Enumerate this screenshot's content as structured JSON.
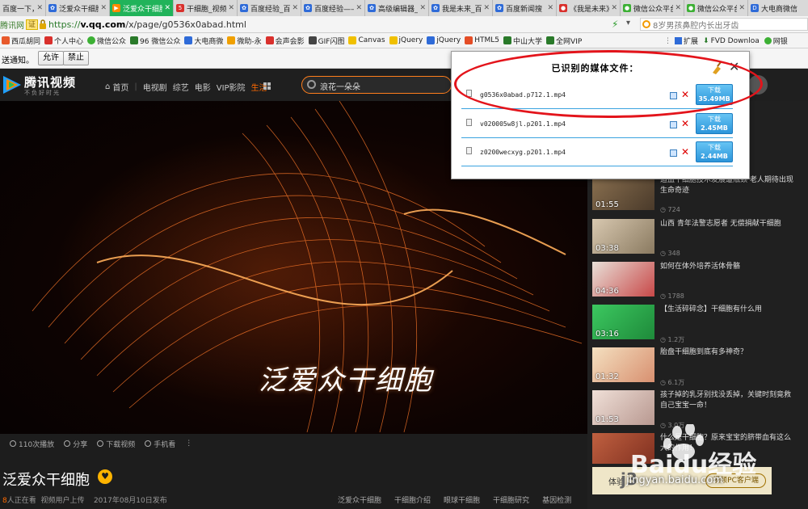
{
  "browser": {
    "tabs": [
      {
        "title": "百度一下，你",
        "favicon_color": "#2f6bd8"
      },
      {
        "title": "泛爱众干细胞",
        "favicon_color": "#2f6bd8"
      },
      {
        "title": "泛爱众干细胞",
        "favicon_color": "#ff8a00",
        "active": true
      },
      {
        "title": "干细胞_视频",
        "favicon_color": "#d9302c"
      },
      {
        "title": "百度经验_百",
        "favicon_color": "#2f6bd8"
      },
      {
        "title": "百度经验——",
        "favicon_color": "#2f6bd8"
      },
      {
        "title": "高级编辑器_",
        "favicon_color": "#2f6bd8"
      },
      {
        "title": "我是未来_百",
        "favicon_color": "#2f6bd8"
      },
      {
        "title": "百度新闻搜",
        "favicon_color": "#2f6bd8"
      },
      {
        "title": "《我是未来》",
        "favicon_color": "#d9302c"
      },
      {
        "title": "微信公众平台",
        "favicon_color": "#3cb034"
      },
      {
        "title": "微信公众平台",
        "favicon_color": "#3cb034"
      },
      {
        "title": "大电商微信",
        "favicon_color": "#2f6bd8"
      }
    ],
    "site_badge": "腾讯网",
    "cert_label": "证",
    "url_scheme": "https://",
    "url_host": "v.qq.com",
    "url_path": "/x/page/g0536x0abad.html",
    "search_placeholder": "8岁男孩鼻腔内长出牙齿",
    "bookmarks": [
      {
        "label": "西瓜胡同",
        "color": "#e85a2c"
      },
      {
        "label": "个人中心",
        "color": "#d9302c"
      },
      {
        "label": "微信公众",
        "color": "#3cb034"
      },
      {
        "label": "96 微信公众",
        "color": "#2a7a2a"
      },
      {
        "label": "大电商微",
        "color": "#2f6bd8"
      },
      {
        "label": "微助-永",
        "color": "#f0a000"
      },
      {
        "label": "会声会影",
        "color": "#d9302c"
      },
      {
        "label": "GIF闪图",
        "color": "#444444"
      },
      {
        "label": "Canvas",
        "color": "#f0c000"
      },
      {
        "label": "jQuery",
        "color": "#f0c000"
      },
      {
        "label": "jQuery",
        "color": "#2f6bd8"
      },
      {
        "label": "HTML5",
        "color": "#e44d26"
      },
      {
        "label": "中山大学",
        "color": "#2a7a2a"
      },
      {
        "label": "全网VIP",
        "color": "#2a7a2a"
      }
    ],
    "bm_extension": "扩展",
    "bm_fvd": "FVD Downloa",
    "bm_bank": "网银",
    "notification": "送通知。",
    "allow_label": "允许",
    "block_label": "禁止"
  },
  "site": {
    "logo_text": "腾讯视频",
    "slogan": "不负好时光",
    "nav": [
      {
        "label": "首页"
      },
      {
        "label": "电视剧"
      },
      {
        "label": "综艺"
      },
      {
        "label": "电影"
      },
      {
        "label": "VIP影院"
      },
      {
        "label": "生活",
        "active": true
      }
    ],
    "search_text": "浪花一朵朵",
    "accent_color": "#ff6a00"
  },
  "player": {
    "title_overlay": "泛爱众干细胞",
    "controls": [
      "110次播放",
      "分享",
      "下载视频",
      "手机看"
    ]
  },
  "video": {
    "title": "泛爱众干细胞",
    "watching_count": "8",
    "watching_suffix": "人正在看",
    "uploader": "视频用户上传",
    "published": "2017年08月10日发布",
    "tags": [
      "泛爱众干细胞",
      "干细胞介绍",
      "眼球干细胞",
      "干细胞研究",
      "基因检测"
    ]
  },
  "recommendations": [
    {
      "title": "造血干细胞技术发展遭瓶颈 老人期待出现生命奇迹",
      "duration": "01:55",
      "views": "724",
      "thumb_color": "#6d5a3c"
    },
    {
      "title": "山西 青年法警志愿者 无偿捐献干细胞",
      "duration": "03:38",
      "views": "348",
      "thumb_color": "#b8a080"
    },
    {
      "title": "如何在体外培养活体骨骼",
      "duration": "04:36",
      "views": "1788",
      "thumb_color": "#c84848"
    },
    {
      "title": "【生活碎碎念】干细胞有什么用",
      "duration": "03:16",
      "views": "1.2万",
      "thumb_color": "#2ea84a"
    },
    {
      "title": "胎盘干细胞到底有多神奇？",
      "duration": "01:32",
      "views": "6.1万",
      "thumb_color": "#e8c8a0"
    },
    {
      "title": "孩子掉的乳牙别找没丢掉，关键时刻竟救自己宝宝一命！",
      "duration": "01:53",
      "views": "3.0万",
      "thumb_color": "#d8c8c0"
    },
    {
      "title": "什么是干细胞？原来宝宝的脐带血有这么大的作用！",
      "duration": "",
      "views": "",
      "thumb_color": "#b05038"
    }
  ],
  "promo": {
    "text": "体验",
    "big": "j3",
    "sub": "视频PC客户端"
  },
  "popup": {
    "title": "已识别的媒体文件：",
    "download_label": "下载",
    "files": [
      {
        "name": "g0536x0abad.p712.1.mp4",
        "size": "35.49MB"
      },
      {
        "name": "v020005w8jl.p201.1.mp4",
        "size": "2.45MB"
      },
      {
        "name": "z0200wecxyg.p201.1.mp4",
        "size": "2.44MB"
      }
    ]
  },
  "watermark": {
    "brand": "Baidu经验",
    "url": "jingyan.baidu.com"
  }
}
